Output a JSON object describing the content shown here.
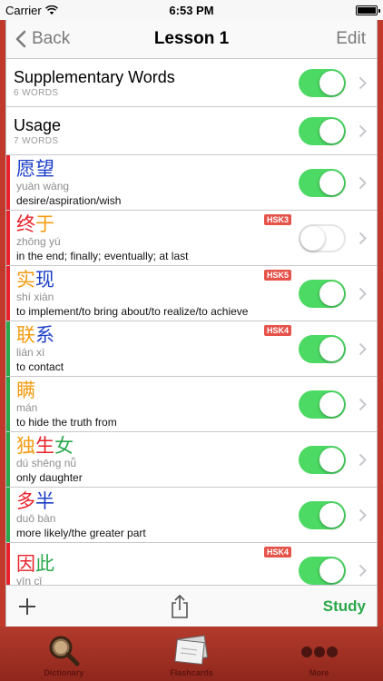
{
  "status": {
    "carrier": "Carrier",
    "time": "6:53 PM"
  },
  "nav": {
    "back_label": "Back",
    "title": "Lesson 1",
    "edit_label": "Edit"
  },
  "sections": [
    {
      "title": "Supplementary Words",
      "subtitle": "6 WORDS",
      "enabled": true
    },
    {
      "title": "Usage",
      "subtitle": "7 WORDS",
      "enabled": true
    }
  ],
  "words": [
    {
      "hanzi": "愿望",
      "pinyin": "yuàn wàng",
      "meaning": "desire/aspiration/wish",
      "badge": "",
      "bar_color": "#e8212a",
      "enabled": true,
      "char_colors": [
        "#1d3fc8",
        "#1d3fc8"
      ]
    },
    {
      "hanzi": "终于",
      "pinyin": "zhōng yú",
      "meaning": "in the end; finally; eventually; at last",
      "badge": "HSK3",
      "bar_color": "#e8212a",
      "enabled": false,
      "char_colors": [
        "#e8212a",
        "#f39c12"
      ]
    },
    {
      "hanzi": "实现",
      "pinyin": "shí xiàn",
      "meaning": "to implement/to bring about/to realize/to achieve",
      "badge": "HSK5",
      "bar_color": "#e8212a",
      "enabled": true,
      "char_colors": [
        "#f39c12",
        "#1d3fc8"
      ]
    },
    {
      "hanzi": "联系",
      "pinyin": "lián xì",
      "meaning": "to contact",
      "badge": "HSK4",
      "bar_color": "#2aa84a",
      "enabled": true,
      "char_colors": [
        "#f39c12",
        "#1d3fc8"
      ]
    },
    {
      "hanzi": "瞒",
      "pinyin": "mán",
      "meaning": "to hide the truth from",
      "badge": "",
      "bar_color": "#2aa84a",
      "enabled": true,
      "char_colors": [
        "#f39c12"
      ]
    },
    {
      "hanzi": "独生女",
      "pinyin": "dú shēng nǚ",
      "meaning": "only daughter",
      "badge": "",
      "bar_color": "#2aa84a",
      "enabled": true,
      "char_colors": [
        "#f39c12",
        "#e8212a",
        "#2aa84a"
      ]
    },
    {
      "hanzi": "多半",
      "pinyin": "duō bàn",
      "meaning": "more likely/the greater part",
      "badge": "",
      "bar_color": "#2aa84a",
      "enabled": true,
      "char_colors": [
        "#e8212a",
        "#1d3fc8"
      ]
    },
    {
      "hanzi": "因此",
      "pinyin": "yīn cǐ",
      "meaning": "",
      "badge": "HSK4",
      "bar_color": "#e8212a",
      "enabled": true,
      "char_colors": [
        "#e8212a",
        "#2aa84a"
      ]
    }
  ],
  "toolbar": {
    "study_label": "Study"
  },
  "tabs": [
    {
      "label": "Dictionary",
      "icon": "magnifier-icon"
    },
    {
      "label": "Flashcards",
      "icon": "flashcards-icon"
    },
    {
      "label": "More",
      "icon": "more-dots-icon"
    }
  ],
  "colors": {
    "toggle_on": "#4cd964",
    "study": "#2aa84a",
    "badge": "#e5534b",
    "tabbar": "#b23a2c"
  }
}
